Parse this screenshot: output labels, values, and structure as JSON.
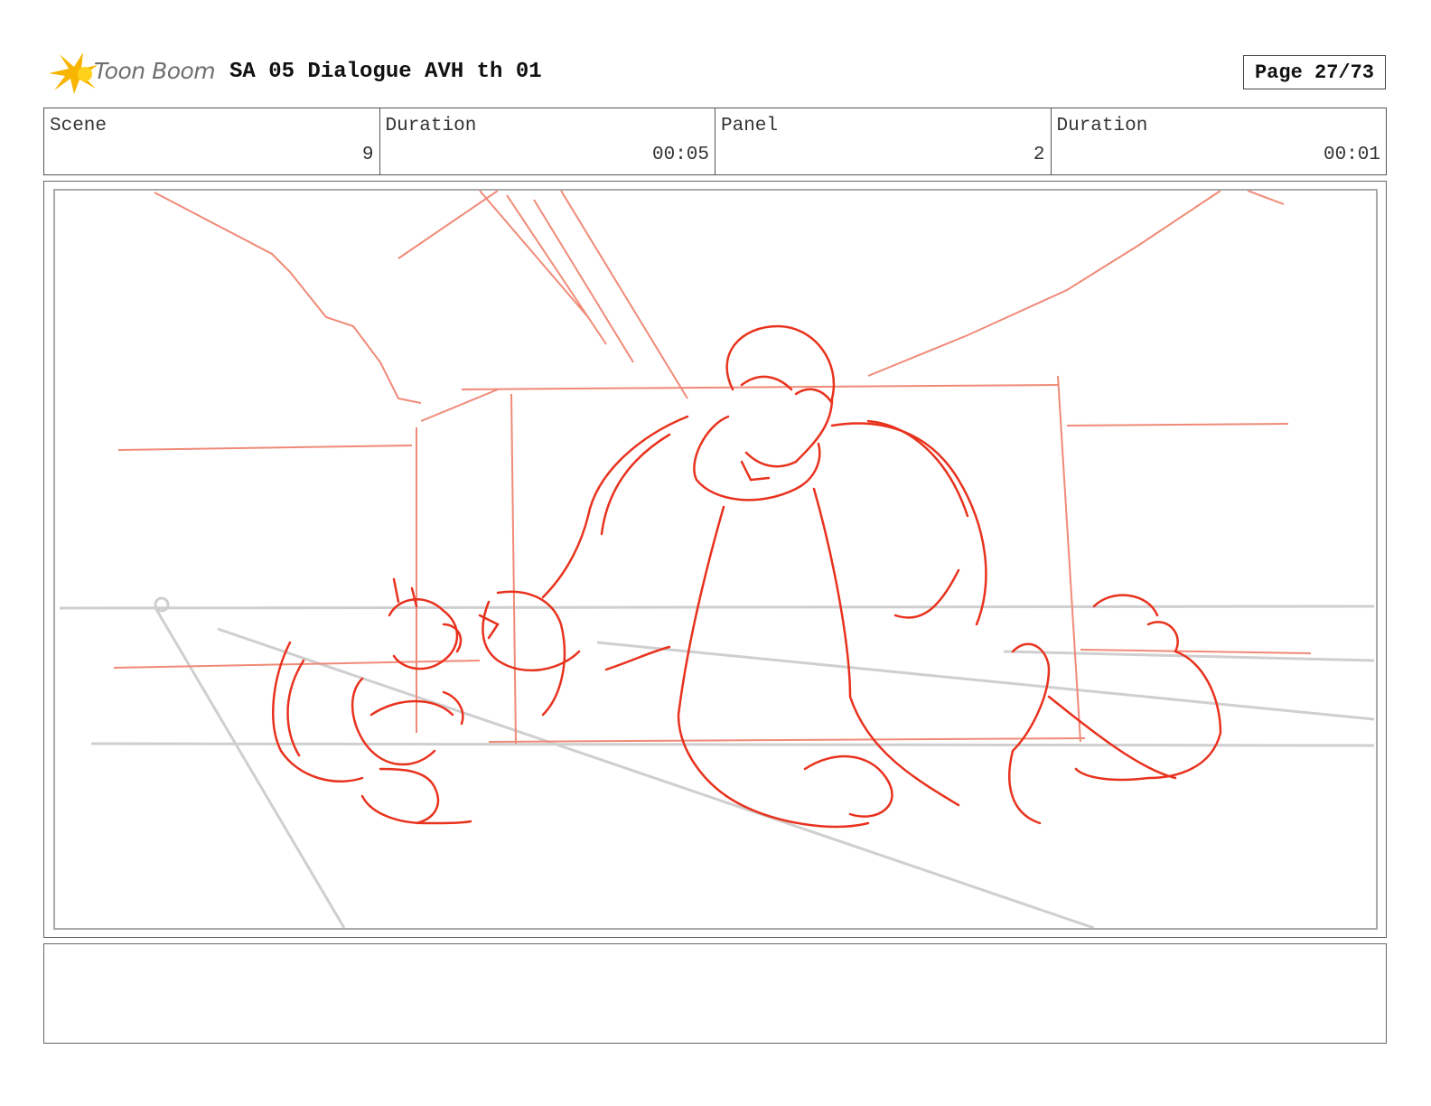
{
  "header": {
    "brand": "Toon Boom",
    "title": "SA 05 Dialogue AVH th 01",
    "page": "Page 27/73"
  },
  "info": {
    "scene_label": "Scene",
    "scene_value": "9",
    "scene_duration_label": "Duration",
    "scene_duration_value": "00:05",
    "panel_label": "Panel",
    "panel_value": "2",
    "panel_duration_label": "Duration",
    "panel_duration_value": "00:01"
  },
  "sketch": {
    "line_color": "#e8321e",
    "light_line_color": "#f08a78",
    "guide_color": "#cfcfcf"
  },
  "notes": {
    "text": ""
  }
}
